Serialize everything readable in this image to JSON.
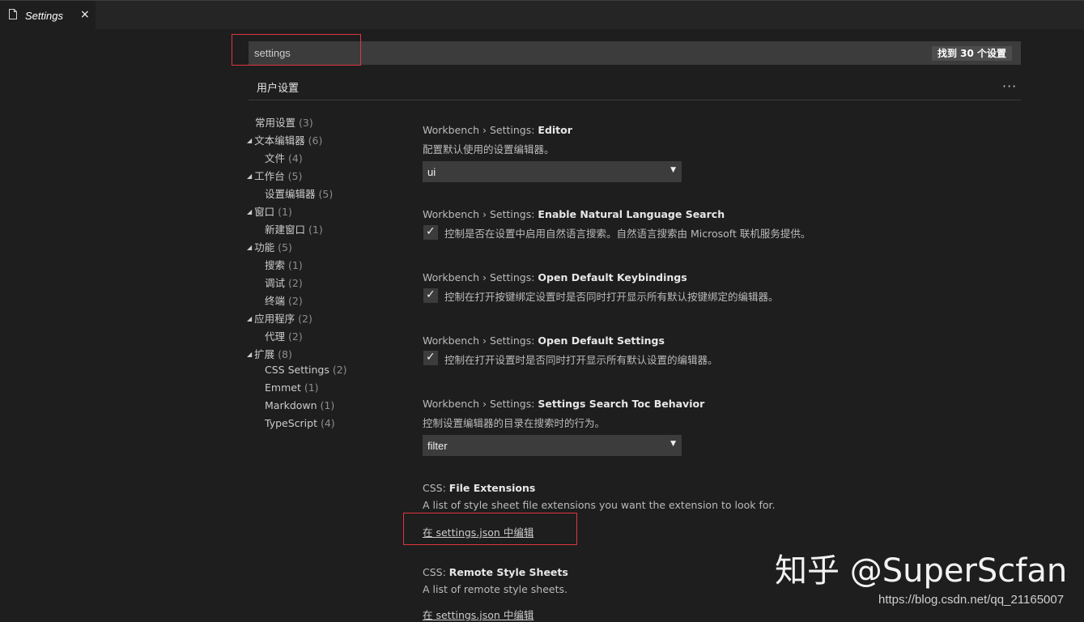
{
  "tab": {
    "title": "Settings",
    "close": "×"
  },
  "search": {
    "value": "settings",
    "result_count": "找到 30 个设置"
  },
  "header": {
    "title": "用户设置",
    "more": "···"
  },
  "toc": [
    {
      "label": "常用设置",
      "count": "(3)",
      "twisty": ""
    },
    {
      "label": "文本编辑器",
      "count": "(6)",
      "twisty": "◢"
    },
    {
      "label": "文件",
      "count": "(4)",
      "twisty": ""
    },
    {
      "label": "工作台",
      "count": "(5)",
      "twisty": "◢"
    },
    {
      "label": "设置编辑器",
      "count": "(5)",
      "twisty": ""
    },
    {
      "label": "窗口",
      "count": "(1)",
      "twisty": "◢"
    },
    {
      "label": "新建窗口",
      "count": "(1)",
      "twisty": ""
    },
    {
      "label": "功能",
      "count": "(5)",
      "twisty": "◢"
    },
    {
      "label": "搜索",
      "count": "(1)",
      "twisty": ""
    },
    {
      "label": "调试",
      "count": "(2)",
      "twisty": ""
    },
    {
      "label": "终端",
      "count": "(2)",
      "twisty": ""
    },
    {
      "label": "应用程序",
      "count": "(2)",
      "twisty": "◢"
    },
    {
      "label": "代理",
      "count": "(2)",
      "twisty": ""
    },
    {
      "label": "扩展",
      "count": "(8)",
      "twisty": "◢"
    },
    {
      "label": "CSS Settings",
      "count": "(2)",
      "twisty": ""
    },
    {
      "label": "Emmet",
      "count": "(1)",
      "twisty": ""
    },
    {
      "label": "Markdown",
      "count": "(1)",
      "twisty": ""
    },
    {
      "label": "TypeScript",
      "count": "(4)",
      "twisty": ""
    }
  ],
  "settings": [
    {
      "category": "Workbench › Settings: ",
      "name": "Editor",
      "description": "配置默认使用的设置编辑器。",
      "value": "ui"
    },
    {
      "category": "Workbench › Settings: ",
      "name": "Enable Natural Language Search",
      "description": "控制是否在设置中启用自然语言搜索。自然语言搜索由 Microsoft 联机服务提供。",
      "checked": true
    },
    {
      "category": "Workbench › Settings: ",
      "name": "Open Default Keybindings",
      "description": "控制在打开按键绑定设置时是否同时打开显示所有默认按键绑定的编辑器。",
      "checked": true
    },
    {
      "category": "Workbench › Settings: ",
      "name": "Open Default Settings",
      "description": "控制在打开设置时是否同时打开显示所有默认设置的编辑器。",
      "checked": true
    },
    {
      "category": "Workbench › Settings: ",
      "name": "Settings Search Toc Behavior",
      "description": "控制设置编辑器的目录在搜索时的行为。",
      "value": "filter"
    },
    {
      "category": "CSS: ",
      "name": "File Extensions",
      "description": "A list of style sheet file extensions you want the extension to look for.",
      "link": "在 settings.json 中编辑"
    },
    {
      "category": "CSS: ",
      "name": "Remote Style Sheets",
      "description": "A list of remote style sheets.",
      "link": "在 settings.json 中编辑"
    }
  ],
  "icons": {
    "check": "✓",
    "dropdown": "▼"
  },
  "watermark": {
    "text": "知乎 @SuperScfan",
    "url": "https://blog.csdn.net/qq_21165007"
  },
  "colors": {
    "highlight": "#e0353f",
    "background": "#1e1e1e",
    "input": "#3c3c3c"
  }
}
